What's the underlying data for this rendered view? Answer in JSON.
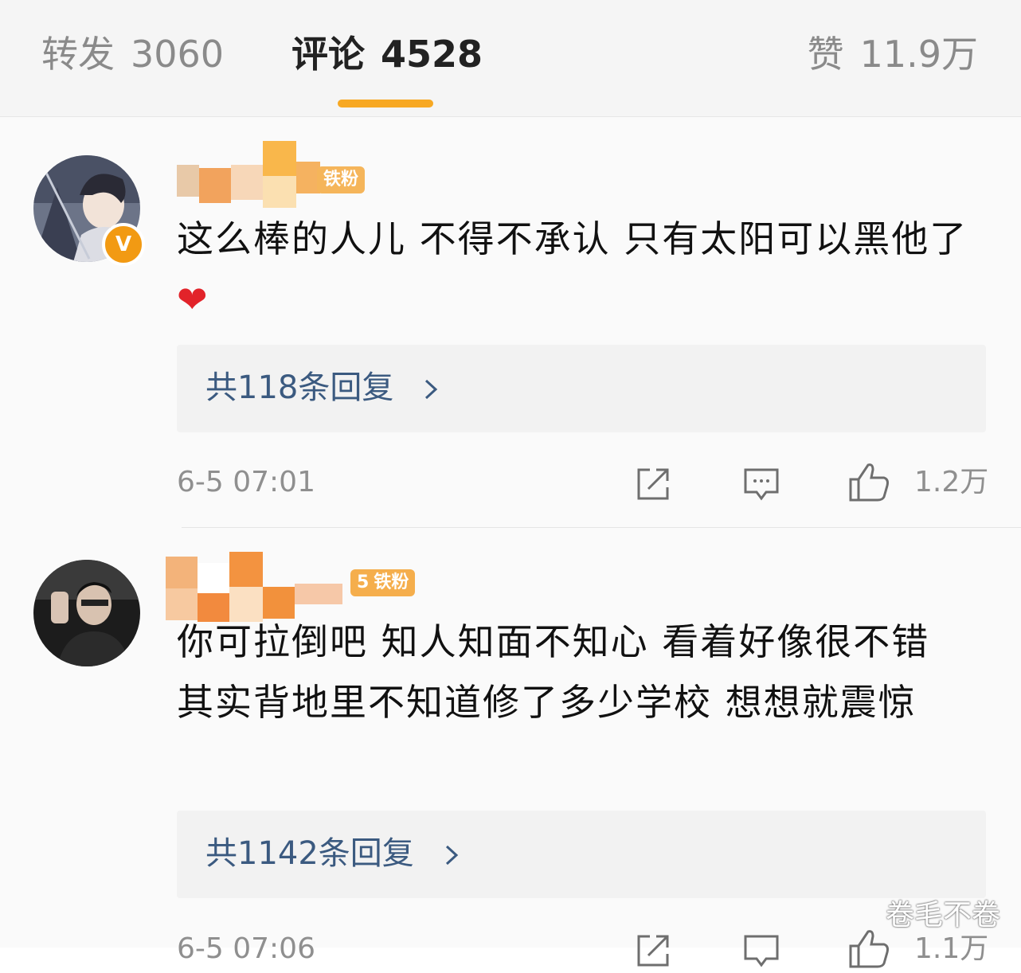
{
  "tabs": {
    "repost": {
      "label": "转发",
      "count": "3060"
    },
    "comment": {
      "label": "评论",
      "count": "4528"
    },
    "like": {
      "label": "赞",
      "count": "11.9万"
    },
    "active": "comment",
    "accent": "#f7a823"
  },
  "comments": [
    {
      "verified_badge": "V",
      "fan_badge": "铁粉",
      "text": "这么棒的人儿 不得不承认 只有太阳可以黑他了",
      "emoji": "❤",
      "replies_label": "共118条回复",
      "time": "6-5 07:01",
      "likes": "1.2万"
    },
    {
      "fan_badge": "铁粉",
      "fan_level": "5",
      "text": "你可拉倒吧 知人知面不知心 看着好像很不错 其实背地里不知道修了多少学校 想想就震惊",
      "replies_label": "共1142条回复",
      "time": "6-5 07:06",
      "likes": "1.1万"
    }
  ],
  "icons": {
    "share": "share-icon",
    "comment": "comment-icon",
    "like": "thumbs-up-icon",
    "reply_arrow": "chevron-right-icon"
  },
  "watermark": "卷毛不卷"
}
